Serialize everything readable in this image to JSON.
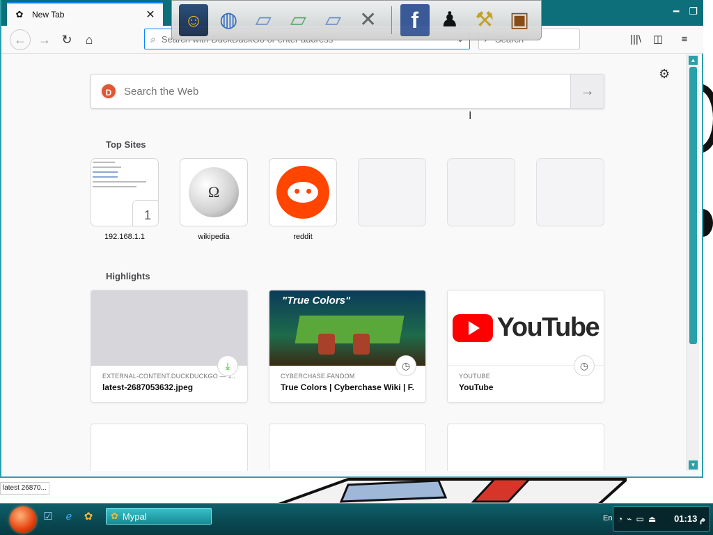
{
  "window": {
    "tab_title": "New Tab",
    "tab_close": "✕",
    "new_tab": "+",
    "minimize": "━",
    "restore": "❐"
  },
  "toolbar": {
    "url_placeholder": "Search with DuckDuckGo or enter address",
    "search_placeholder": "Search",
    "back": "←",
    "forward": "→",
    "reload": "↻",
    "home": "⌂",
    "library": "|||\\",
    "sidebar": "◫",
    "menu": "≡"
  },
  "dock": {
    "items": [
      {
        "name": "naruto",
        "glyph": "☺"
      },
      {
        "name": "globe",
        "glyph": "◍"
      },
      {
        "name": "folder",
        "glyph": "▱"
      },
      {
        "name": "folder-green",
        "glyph": "▱"
      },
      {
        "name": "folder-blue",
        "glyph": "▱"
      },
      {
        "name": "tools",
        "glyph": "✕"
      },
      {
        "name": "facebook",
        "glyph": "f"
      },
      {
        "name": "shirt",
        "glyph": "♟"
      },
      {
        "name": "hammer",
        "glyph": "⚒"
      },
      {
        "name": "bucket",
        "glyph": "▣"
      }
    ]
  },
  "newtab": {
    "search_placeholder": "Search the Web",
    "search_go": "→",
    "gear": "⚙",
    "top_sites_title": "Top Sites",
    "highlights_title": "Highlights",
    "top_sites": [
      {
        "label": "192.168.1.1",
        "badge": "1"
      },
      {
        "label": "wikipedia",
        "glyph": "Ω"
      },
      {
        "label": "reddit"
      },
      {
        "label": ""
      },
      {
        "label": ""
      },
      {
        "label": ""
      }
    ],
    "highlights": [
      {
        "source": "EXTERNAL-CONTENT.DUCKDUCKGO — 1...",
        "title": "latest-2687053632.jpeg",
        "badge": "⤓"
      },
      {
        "source": "CYBERCHASE.FANDOM",
        "title": "True Colors | Cyberchase Wiki | F...",
        "badge": "◷",
        "image_text": "\"True Colors\""
      },
      {
        "source": "YOUTUBE",
        "title": "YouTube",
        "badge": "◷",
        "logo_text": "YouTube"
      }
    ]
  },
  "status_text": "latest 26870...",
  "taskbar": {
    "task_label": "Mypal",
    "lang": "En",
    "clock": "01:13 م",
    "quick_icons": [
      "☑",
      "ℯ",
      "✿"
    ]
  },
  "colors": {
    "accent": "#2aa0a8",
    "ddg": "#de5833",
    "reddit": "#ff4500",
    "youtube": "#ff0000"
  }
}
